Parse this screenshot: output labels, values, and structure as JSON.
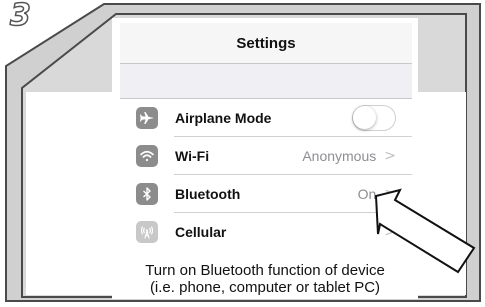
{
  "step_number": "3",
  "nav": {
    "title": "Settings"
  },
  "rows": [
    {
      "label": "Airplane Mode",
      "icon": "airplane-icon",
      "control": "toggle",
      "toggle_on": false
    },
    {
      "label": "Wi-Fi",
      "icon": "wifi-icon",
      "value": "Anonymous",
      "chevron": ">"
    },
    {
      "label": "Bluetooth",
      "icon": "bluetooth-icon",
      "value": "On",
      "chevron": ">"
    },
    {
      "label": "Cellular",
      "icon": "cellular-antenna-icon",
      "chevron": ">"
    }
  ],
  "caption": {
    "line1": "Turn on Bluetooth function of device",
    "line2": "(i.e. phone, computer or tablet PC)"
  },
  "colors": {
    "frame_border": "#555555",
    "frame_fill": "#d4d4d4",
    "icon_bg": "#8c8c8c",
    "secondary_text": "#8e8e93"
  }
}
